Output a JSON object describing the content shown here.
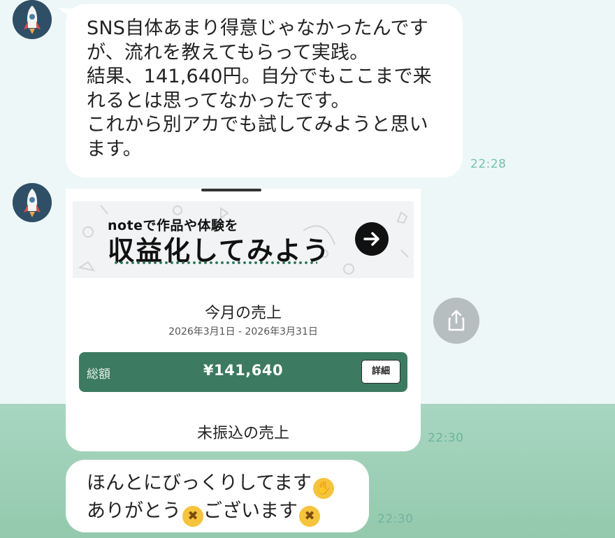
{
  "chat": {
    "messages": [
      {
        "lines": [
          "SNS自体あまり得意じゃなかったんですが、流れを教えてもらって実践。",
          "結果、141,640円。自分でもここまで来れるとは思ってなかったです。",
          "これから別アカでも試してみようと思います。"
        ],
        "display_lines": [
          "SNS自体あまり得意じゃなかったんです",
          "が、流れを教えてもらって実践。",
          "結果、141,640円。自分でもここまで来",
          "れるとは思ってなかったです。",
          "これから別アカでも試してみようと思い",
          "ます。"
        ],
        "time": "22:28"
      },
      {
        "image_card": {
          "banner_small": "noteで作品や体験を",
          "banner_big": "収益化してみよう",
          "sales_title": "今月の売上",
          "period": "2026年3月1日 - 2026年3月31日",
          "total_label": "総額",
          "total_amount": "¥141,640",
          "detail_button": "詳細",
          "unpaid_title": "未振込の売上"
        },
        "time": "22:30"
      },
      {
        "display_lines": [
          "ほんとにびっくりしてます",
          "ありがとう",
          "ございます"
        ],
        "time": "22:30"
      }
    ]
  },
  "icons": {
    "avatar": "rocket-avatar-icon",
    "share": "share-icon",
    "arrow": "arrow-right-icon",
    "emoji_1": "face-with-hand-over-mouth-emoji",
    "emoji_2": "loudly-crying-face-emoji"
  },
  "colors": {
    "background_top": "#eef7f8",
    "background_bottom": "#9fcfb6",
    "time_text": "#75c2ad",
    "total_bar": "#3c7a61",
    "avatar_bg": "#2f4f66",
    "share_button": "#b7bec0"
  }
}
